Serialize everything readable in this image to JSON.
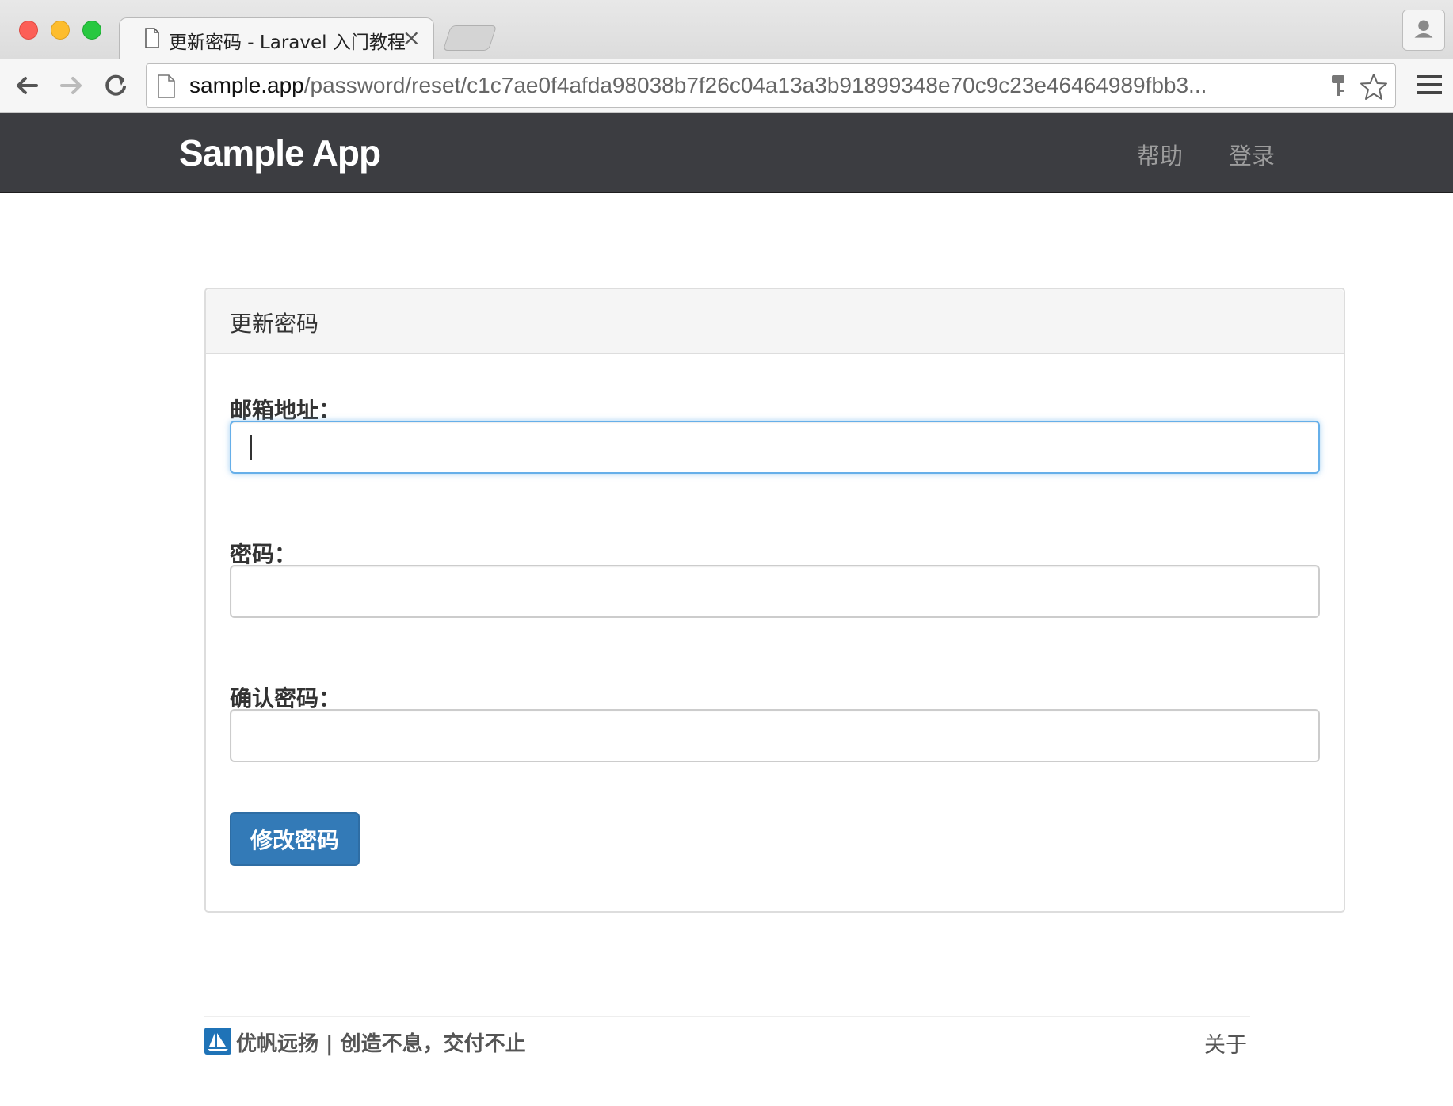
{
  "browser": {
    "tab_title": "更新密码 - Laravel 入门教程",
    "tab_close": "×",
    "url_host": "sample.app",
    "url_path": "/password/reset/c1c7ae0f4afda98038b7f26c04a13a3b91899348e70c9c23e46464989fbb3..."
  },
  "navbar": {
    "brand": "Sample App",
    "links": [
      {
        "label": "帮助"
      },
      {
        "label": "登录"
      }
    ]
  },
  "panel": {
    "heading": "更新密码",
    "fields": [
      {
        "label": "邮箱地址：",
        "value": "",
        "focused": true
      },
      {
        "label": "密码：",
        "value": "",
        "focused": false
      },
      {
        "label": "确认密码：",
        "value": "",
        "focused": false
      }
    ],
    "submit_label": "修改密码"
  },
  "footer": {
    "left_text": "优帆远扬 | 创造不息，交付不止",
    "right_link": "关于"
  },
  "colors": {
    "navbar_bg": "#3c3d41",
    "primary_button": "#337ab7",
    "focus_border": "#66afe9",
    "logo_blue": "#1f73b7"
  }
}
